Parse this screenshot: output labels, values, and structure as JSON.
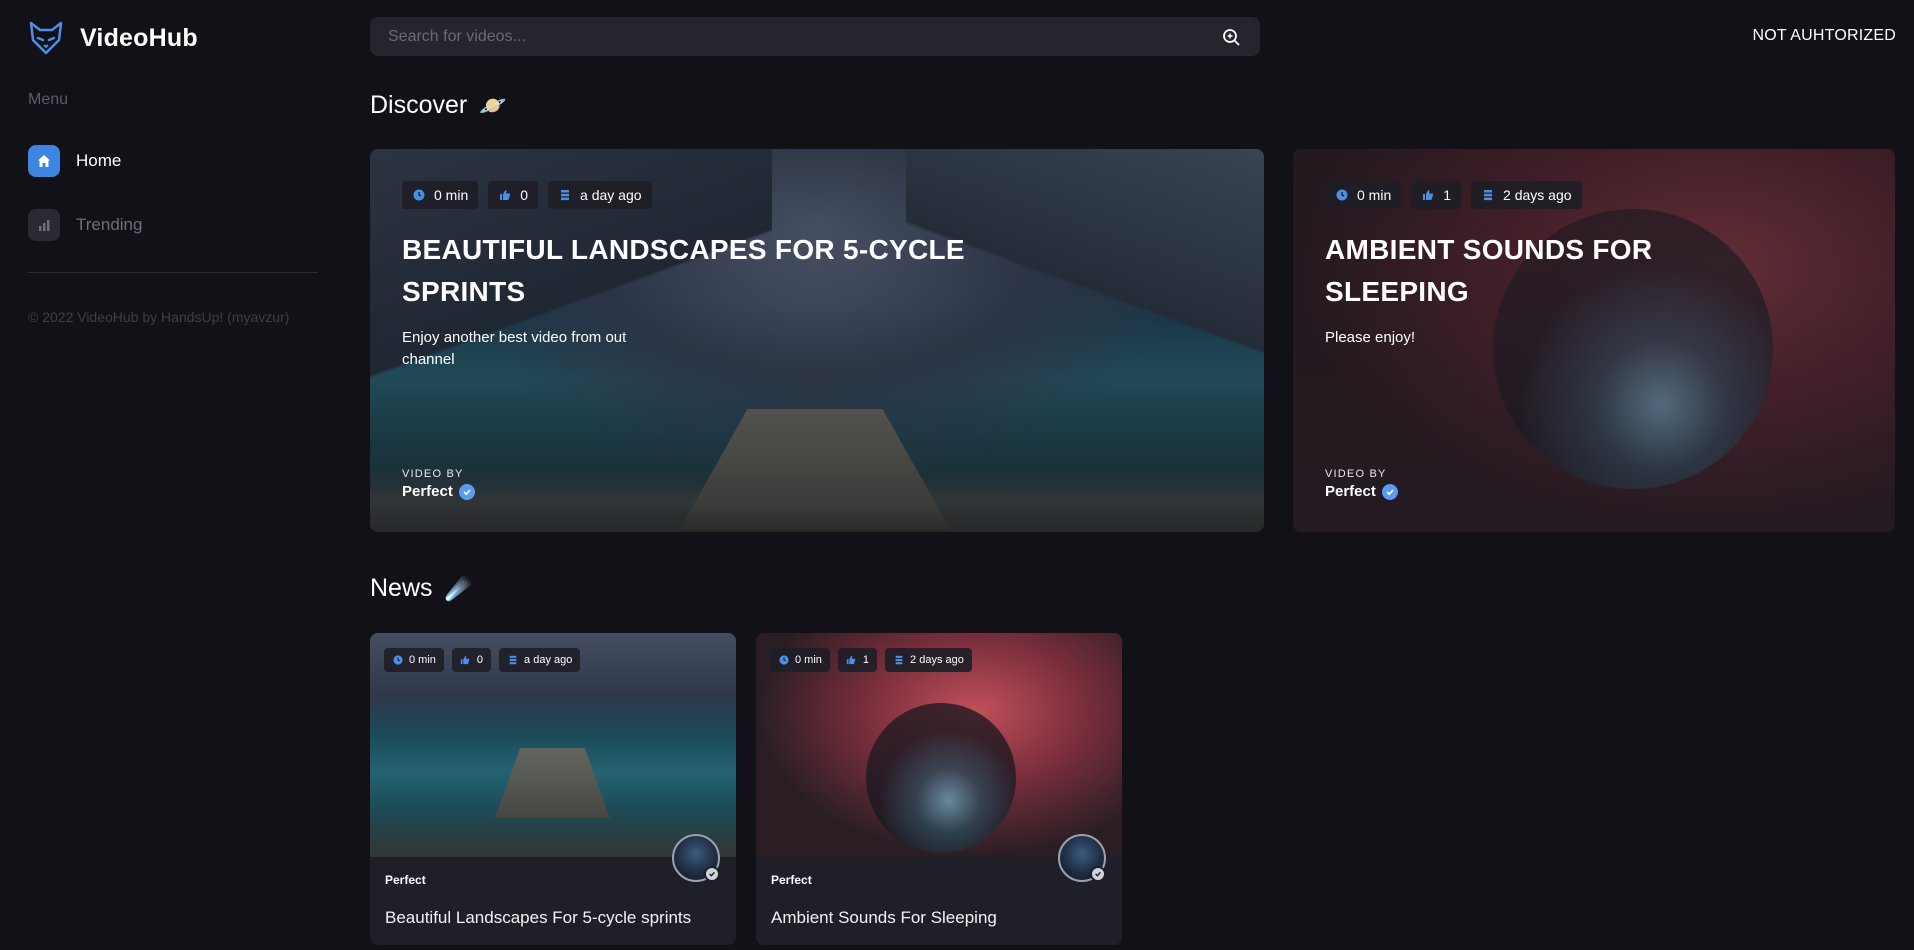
{
  "app": {
    "name": "VideoHub"
  },
  "sidebar": {
    "menu_title": "Menu",
    "items": [
      {
        "label": "Home",
        "icon": "home-icon",
        "active": true
      },
      {
        "label": "Trending",
        "icon": "chart-icon",
        "active": false
      }
    ],
    "copyright": "© 2022 VideoHub by HandsUp! (myavzur)"
  },
  "header": {
    "search_placeholder": "Search for videos...",
    "auth_status": "NOT AUHTORIZED"
  },
  "discover": {
    "title": "Discover",
    "emoji": "🪐",
    "cards": [
      {
        "duration": "0 min",
        "likes": "0",
        "date": "a day ago",
        "title": "BEAUTIFUL LANDSCAPES FOR 5-CYCLE SPRINTS",
        "description": "Enjoy another best video from out channel",
        "video_by_label": "VIDEO BY",
        "author": "Perfect"
      },
      {
        "duration": "0 min",
        "likes": "1",
        "date": "2 days ago",
        "title": "AMBIENT SOUNDS FOR SLEEPING",
        "description": "Please enjoy!",
        "video_by_label": "VIDEO BY",
        "author": "Perfect"
      }
    ]
  },
  "news": {
    "title": "News",
    "emoji": "☄️",
    "cards": [
      {
        "duration": "0 min",
        "likes": "0",
        "date": "a day ago",
        "author": "Perfect",
        "title": "Beautiful Landscapes For 5-cycle sprints"
      },
      {
        "duration": "0 min",
        "likes": "1",
        "date": "2 days ago",
        "author": "Perfect",
        "title": "Ambient Sounds For Sleeping"
      }
    ]
  },
  "colors": {
    "background": "#121117",
    "accent": "#3d85e0",
    "card": "#1f1f27",
    "verified": "#5a9af0"
  }
}
